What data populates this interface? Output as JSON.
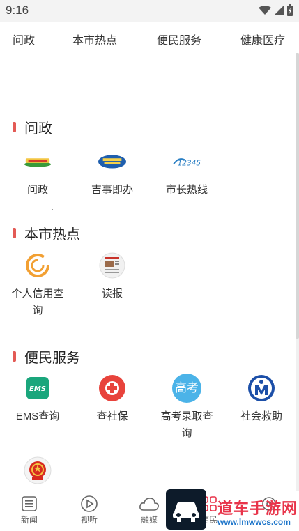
{
  "status_bar": {
    "time": "9:16"
  },
  "tabs": [
    {
      "label": "问政"
    },
    {
      "label": "本市热点"
    },
    {
      "label": "便民服务"
    },
    {
      "label": "健康医疗"
    }
  ],
  "sections": [
    {
      "title": "问政",
      "items": [
        {
          "label": "问政",
          "icon": "wenzheng-banner-icon"
        },
        {
          "label": "吉事即办",
          "icon": "jishijiban-oval-icon"
        },
        {
          "label": "市长热线",
          "icon": "hotline-12345-icon"
        }
      ]
    },
    {
      "title": "本市热点",
      "items": [
        {
          "label": "个人信用查询",
          "label_line1": "个人信用查",
          "label_line2": "询",
          "icon": "credit-c-icon"
        },
        {
          "label": "读报",
          "icon": "newspaper-icon"
        }
      ]
    },
    {
      "title": "便民服务",
      "items": [
        {
          "label": "EMS查询",
          "icon": "ems-icon"
        },
        {
          "label": "查社保",
          "icon": "social-security-icon"
        },
        {
          "label": "高考录取查询",
          "label_line1": "高考录取查",
          "label_line2": "询",
          "icon": "gaokao-icon",
          "icon_text": "高考"
        },
        {
          "label": "社会救助",
          "icon": "social-aid-icon"
        },
        {
          "label": "",
          "icon": "national-emblem-icon"
        }
      ]
    }
  ],
  "bottom_nav": [
    {
      "label": "新闻",
      "icon": "list-icon"
    },
    {
      "label": "视听",
      "icon": "play-circle-icon"
    },
    {
      "label": "融媒",
      "icon": "cloud-icon"
    },
    {
      "label": "便民",
      "icon": "grid-icon"
    },
    {
      "label": "",
      "icon": "settings-icon"
    }
  ],
  "watermark": {
    "text": "道车手游网",
    "url": "www.lmwwcs.com"
  },
  "colors": {
    "section_accent": "#e35a55",
    "ems_green": "#1aa67c",
    "social_security_red": "#e8433c",
    "gaokao_blue": "#4bb3e8",
    "aid_blue": "#1c4fa8",
    "credit_orange": "#f2a033"
  }
}
